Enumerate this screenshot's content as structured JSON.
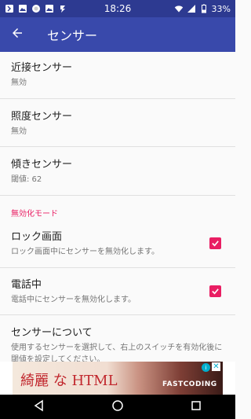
{
  "status_bar": {
    "time": "18:26",
    "battery_percent": "33%",
    "icons": [
      "notification-icon",
      "image-icon",
      "circle-icon",
      "image-icon",
      "lightning-icon",
      "wifi-icon",
      "signal-icon",
      "battery-icon"
    ]
  },
  "app_bar": {
    "title": "センサー",
    "back_icon": "arrow-back-icon"
  },
  "prefs": {
    "proximity": {
      "title": "近接センサー",
      "summary": "無効"
    },
    "light": {
      "title": "照度センサー",
      "summary": "無効"
    },
    "tilt": {
      "title": "傾きセンサー",
      "summary": "閾値: 62"
    }
  },
  "category_disable_mode": "無効化モード",
  "toggles": {
    "lock_screen": {
      "title": "ロック画面",
      "summary": "ロック画面中にセンサーを無効化します。",
      "checked": true
    },
    "call": {
      "title": "電話中",
      "summary": "電話中にセンサーを無効化します。",
      "checked": true
    }
  },
  "about": {
    "title": "センサーについて",
    "summary": "使用するセンサーを選択して、右上のスイッチを有効化後に閾値を設定してください。"
  },
  "ad": {
    "headline": "綺麗 な HTML",
    "brand": "FASTCODING",
    "info_glyph": "i",
    "close_glyph": "✕"
  },
  "colors": {
    "primary": "#3949ab",
    "primary_dark": "#2d3a91",
    "accent": "#e91e63"
  }
}
